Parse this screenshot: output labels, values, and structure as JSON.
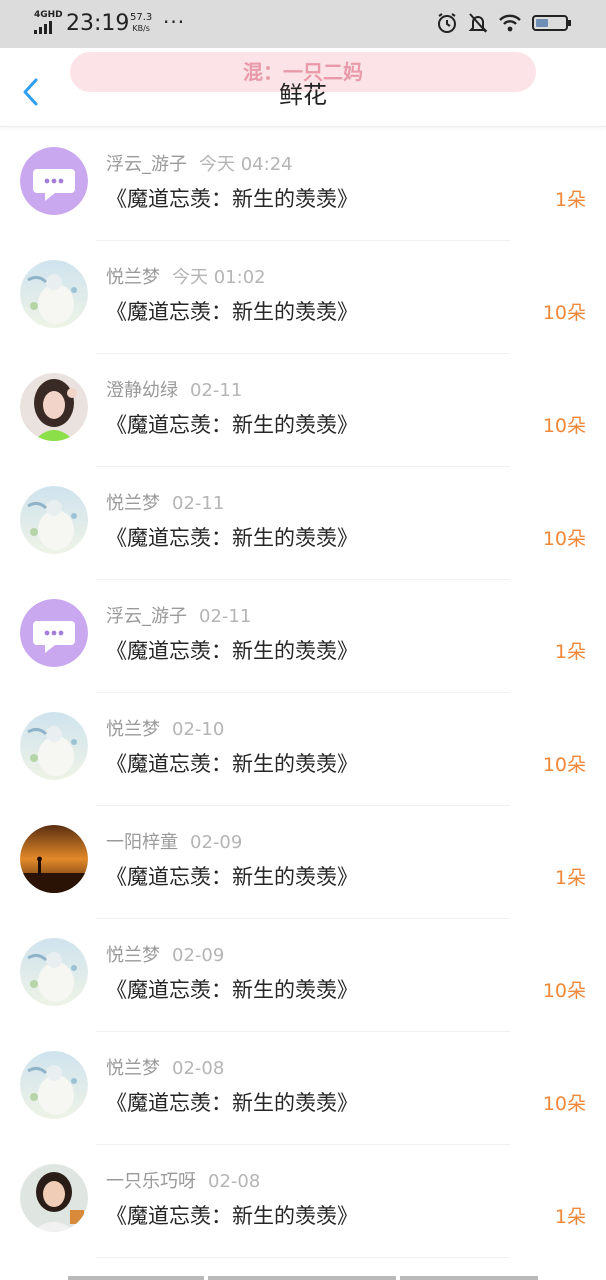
{
  "status_bar": {
    "network": "4GHD",
    "time": "23:19",
    "speed_value": "57.3",
    "speed_unit": "KB/s",
    "more": "···",
    "icons": [
      "alarm-icon",
      "mute-bell-icon",
      "wifi-icon",
      "battery-icon"
    ]
  },
  "header": {
    "banner": "混：一只二妈",
    "title": "鲜花",
    "back_icon": "chevron-left-icon"
  },
  "colors": {
    "accent": "#2f9ff0",
    "count": "#f0883a",
    "banner_bg": "#fbe3e7",
    "banner_text": "#e99aa9"
  },
  "records": [
    {
      "user": "浮云_游子",
      "date": "今天 04:24",
      "book": "《魔道忘羡：新生的羡羡》",
      "count": "1朵",
      "avatar": "chat-bubble"
    },
    {
      "user": "悦兰梦",
      "date": "今天 01:02",
      "book": "《魔道忘羡：新生的羡羡》",
      "count": "10朵",
      "avatar": "anime-art"
    },
    {
      "user": "澄静幼绿",
      "date": "02-11",
      "book": "《魔道忘羡：新生的羡羡》",
      "count": "10朵",
      "avatar": "girl-photo"
    },
    {
      "user": "悦兰梦",
      "date": "02-11",
      "book": "《魔道忘羡：新生的羡羡》",
      "count": "10朵",
      "avatar": "anime-art"
    },
    {
      "user": "浮云_游子",
      "date": "02-11",
      "book": "《魔道忘羡：新生的羡羡》",
      "count": "1朵",
      "avatar": "chat-bubble"
    },
    {
      "user": "悦兰梦",
      "date": "02-10",
      "book": "《魔道忘羡：新生的羡羡》",
      "count": "10朵",
      "avatar": "anime-art"
    },
    {
      "user": "一阳梓童",
      "date": "02-09",
      "book": "《魔道忘羡：新生的羡羡》",
      "count": "1朵",
      "avatar": "sunset-photo"
    },
    {
      "user": "悦兰梦",
      "date": "02-09",
      "book": "《魔道忘羡：新生的羡羡》",
      "count": "10朵",
      "avatar": "anime-art"
    },
    {
      "user": "悦兰梦",
      "date": "02-08",
      "book": "《魔道忘羡：新生的羡羡》",
      "count": "10朵",
      "avatar": "anime-art"
    },
    {
      "user": "一只乐巧呀",
      "date": "02-08",
      "book": "《魔道忘羡：新生的羡羡》",
      "count": "1朵",
      "avatar": "woman-photo"
    }
  ]
}
